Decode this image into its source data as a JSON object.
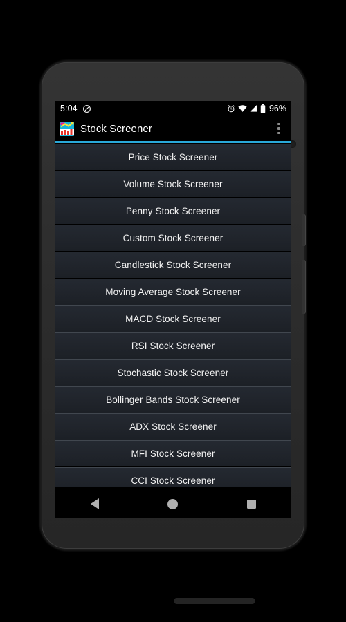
{
  "device": {
    "name": "android-phone",
    "bezel_color": "#2e2e2e"
  },
  "status_bar": {
    "clock": "5:04",
    "dnd_icon": "do-not-disturb-icon",
    "alarm_icon": "alarm-clock-icon",
    "wifi_icon": "wifi-icon",
    "signal_icon": "cellular-signal-icon",
    "battery_icon": "battery-icon",
    "battery_percent": "96%"
  },
  "action_bar": {
    "app_icon": "stock-chart-app-icon",
    "title": "Stock Screener",
    "overflow_icon": "overflow-menu-icon",
    "accent_color": "#29a8d8"
  },
  "list": {
    "items": [
      {
        "label": "Price Stock Screener"
      },
      {
        "label": "Volume Stock Screener"
      },
      {
        "label": "Penny Stock Screener"
      },
      {
        "label": "Custom Stock Screener"
      },
      {
        "label": "Candlestick Stock Screener"
      },
      {
        "label": "Moving Average Stock Screener"
      },
      {
        "label": "MACD Stock Screener"
      },
      {
        "label": "RSI Stock Screener"
      },
      {
        "label": "Stochastic Stock Screener"
      },
      {
        "label": "Bollinger Bands Stock Screener"
      },
      {
        "label": "ADX Stock Screener"
      },
      {
        "label": "MFI Stock Screener"
      },
      {
        "label": "CCI Stock Screener"
      }
    ]
  },
  "nav_bar": {
    "back_label": "back-icon",
    "home_label": "home-icon",
    "recents_label": "recents-icon"
  }
}
